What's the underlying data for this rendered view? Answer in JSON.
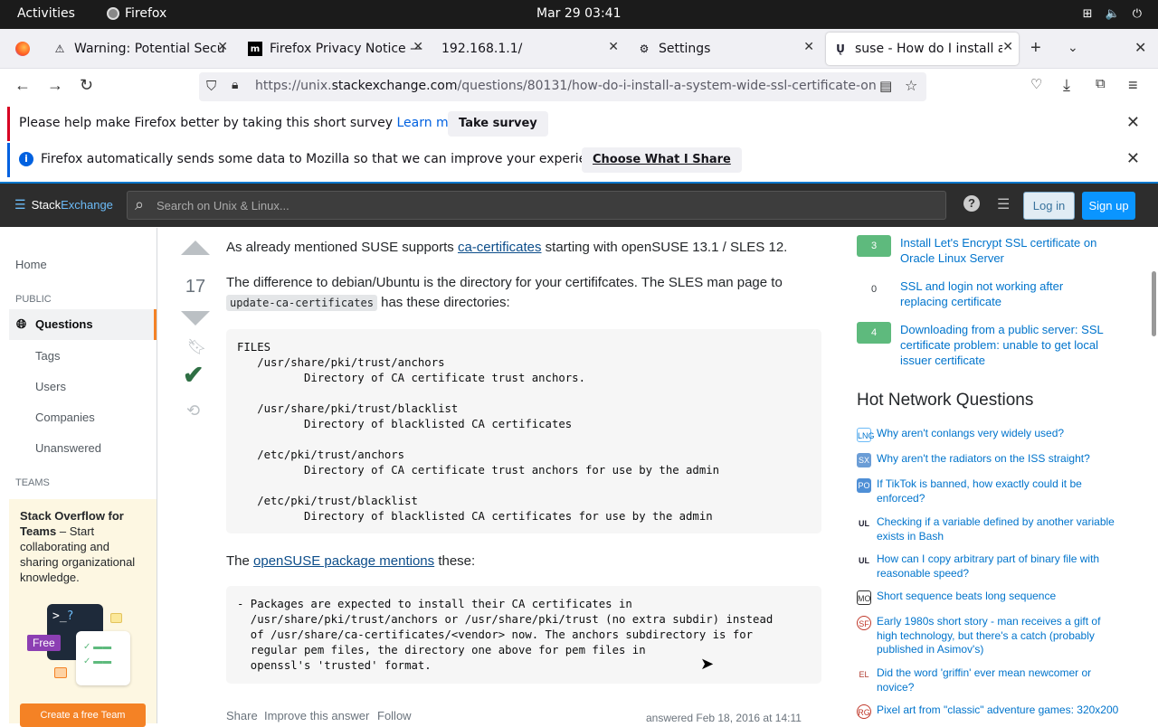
{
  "topbar": {
    "activities": "Activities",
    "app_name": "Firefox",
    "clock": "Mar 29  03:41"
  },
  "tabs": [
    {
      "label": "Warning: Potential Secu",
      "icon": "warning-icon"
    },
    {
      "label": "Firefox Privacy Notice —",
      "icon": "mozilla-icon"
    },
    {
      "label": "192.168.1.1/",
      "icon": ""
    },
    {
      "label": "Settings",
      "icon": "gear-icon"
    },
    {
      "label": "suse - How do I install a",
      "icon": "unix-se-icon"
    }
  ],
  "urlbar": {
    "prefix": "https://unix.",
    "domain": "stackexchange.com",
    "path": "/questions/80131/how-do-i-install-a-system-wide-ssl-certificate-on"
  },
  "survey_bar": {
    "message": "Please help make Firefox better by taking this short survey",
    "link": "Learn more",
    "button": "Take survey"
  },
  "data_bar": {
    "message": "Firefox automatically sends some data to Mozilla so that we can improve your experience.",
    "button": "Choose What I Share"
  },
  "se_header": {
    "logo_a": "Stack",
    "logo_b": "Exchange",
    "search_placeholder": "Search on Unix & Linux...",
    "login": "Log in",
    "signup": "Sign up"
  },
  "leftnav": {
    "home": "Home",
    "public": "PUBLIC",
    "questions": "Questions",
    "tags": "Tags",
    "users": "Users",
    "companies": "Companies",
    "unanswered": "Unanswered",
    "teams": "TEAMS",
    "teams_title": "Stack Overflow for Teams",
    "teams_desc": " – Start collaborating and sharing organizational knowledge.",
    "free_badge": "Free",
    "cta": "Create a free Team"
  },
  "answer": {
    "votes": "17",
    "p1_before": "As already mentioned SUSE supports ",
    "p1_link": "ca-certificates",
    "p1_after": " starting with openSUSE 13.1 / SLES 12.",
    "p2_before": "The difference to debian/Ubuntu is the directory for your certififcates. The SLES man page to ",
    "p2_code": "update-ca-certificates",
    "p2_after": " has these directories:",
    "code1": "FILES\n   /usr/share/pki/trust/anchors\n          Directory of CA certificate trust anchors.\n\n   /usr/share/pki/trust/blacklist\n          Directory of blacklisted CA certificates\n\n   /etc/pki/trust/anchors\n          Directory of CA certificate trust anchors for use by the admin\n\n   /etc/pki/trust/blacklist\n          Directory of blacklisted CA certificates for use by the admin",
    "p3_before": "The ",
    "p3_link": "openSUSE package mentions",
    "p3_after": " these:",
    "code2": "- Packages are expected to install their CA certificates in\n  /usr/share/pki/trust/anchors or /usr/share/pki/trust (no extra subdir) instead\n  of /usr/share/ca-certificates/<vendor> now. The anchors subdirectory is for\n  regular pem files, the directory one above for pem files in\n  openssl's 'trusted' format.",
    "share": "Share",
    "improve": "Improve this answer",
    "follow": "Follow",
    "answered": "answered Feb 18, 2016 at 14:11"
  },
  "related": [
    {
      "score": "3",
      "title": "Install Let's Encrypt SSL certificate on Oracle Linux Server",
      "accepted": true
    },
    {
      "score": "0",
      "title": "SSL and login not working after replacing certificate",
      "accepted": false
    },
    {
      "score": "4",
      "title": "Downloading from a public server: SSL certificate problem: unable to get local issuer certificate",
      "accepted": true
    }
  ],
  "hnq_title": "Hot Network Questions",
  "hnq": [
    {
      "site": "LNG",
      "title": "Why aren't conlangs very widely used?"
    },
    {
      "site": "SX",
      "title": "Why aren't the radiators on the ISS straight?"
    },
    {
      "site": "PO",
      "title": "If TikTok is banned, how exactly could it be enforced?"
    },
    {
      "site": "UL",
      "title": "Checking if a variable defined by another variable exists in Bash"
    },
    {
      "site": "UL",
      "title": "How can I copy arbitrary part of binary file with reasonable speed?"
    },
    {
      "site": "MO",
      "title": "Short sequence beats long sequence"
    },
    {
      "site": "SF",
      "title": "Early 1980s short story - man receives a gift of high technology, but there's a catch (probably published in Asimov's)"
    },
    {
      "site": "EL",
      "title": "Did the word 'griffin' ever mean newcomer or novice?"
    },
    {
      "site": "RG",
      "title": "Pixel art from \"classic\" adventure games: 320x200"
    }
  ],
  "colors": {
    "se_orange": "#f48225",
    "se_blue": "#0a95ff",
    "accepted_green": "#5eba7d",
    "link_blue": "#0074cc"
  }
}
